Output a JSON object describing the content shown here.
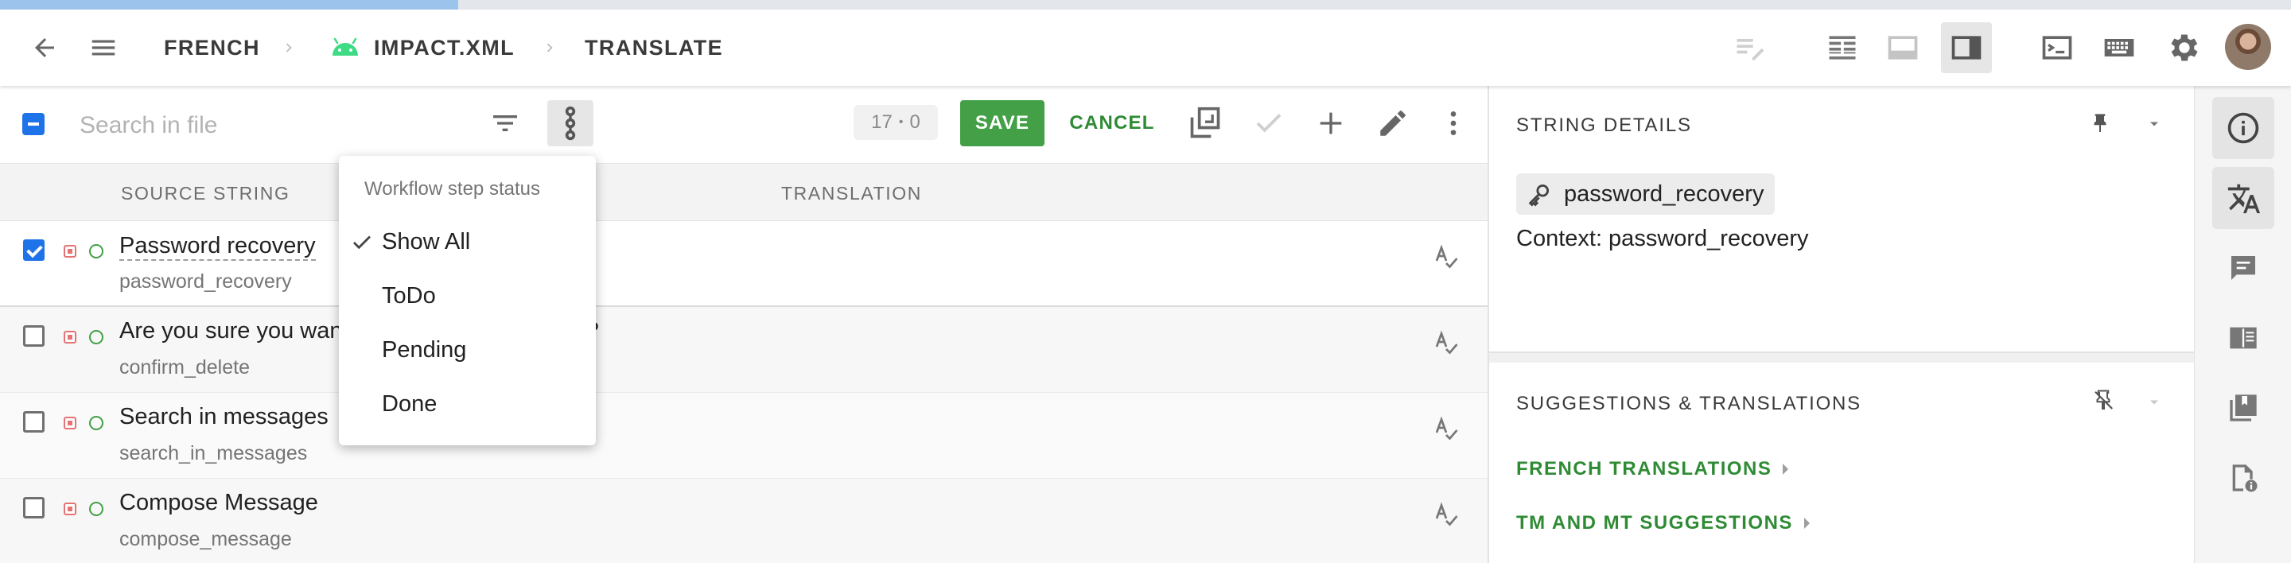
{
  "progress": {
    "fraction": 0.2
  },
  "header": {
    "breadcrumbs": [
      {
        "label": "FRENCH"
      },
      {
        "label": "IMPACT.XML"
      },
      {
        "label": "TRANSLATE"
      }
    ],
    "accent_color": "#3ddc84"
  },
  "toolbar": {
    "search_placeholder": "Search in file",
    "counter_left": "17",
    "counter_sep": "•",
    "counter_right": "0",
    "save_label": "SAVE",
    "cancel_label": "CANCEL",
    "save_color": "#43a047"
  },
  "columns": {
    "source": "SOURCE STRING",
    "translation": "TRANSLATION"
  },
  "rows": [
    {
      "text": "Password recovery",
      "key": "password_recovery",
      "checked": true
    },
    {
      "text": "Are you sure you want to delete this message?",
      "key": "confirm_delete",
      "checked": false
    },
    {
      "text": "Search in messages",
      "key": "search_in_messages",
      "checked": false
    },
    {
      "text": "Compose Message",
      "key": "compose_message",
      "checked": false
    }
  ],
  "dropdown": {
    "title": "Workflow step status",
    "items": [
      {
        "label": "Show All",
        "selected": true
      },
      {
        "label": "ToDo",
        "selected": false
      },
      {
        "label": "Pending",
        "selected": false
      },
      {
        "label": "Done",
        "selected": false
      }
    ]
  },
  "string_details": {
    "title": "STRING DETAILS",
    "key": "password_recovery",
    "context": "Context: password_recovery"
  },
  "suggestions": {
    "title": "SUGGESTIONS & TRANSLATIONS",
    "links": [
      {
        "label": "FRENCH TRANSLATIONS"
      },
      {
        "label": "TM AND MT SUGGESTIONS"
      }
    ]
  }
}
